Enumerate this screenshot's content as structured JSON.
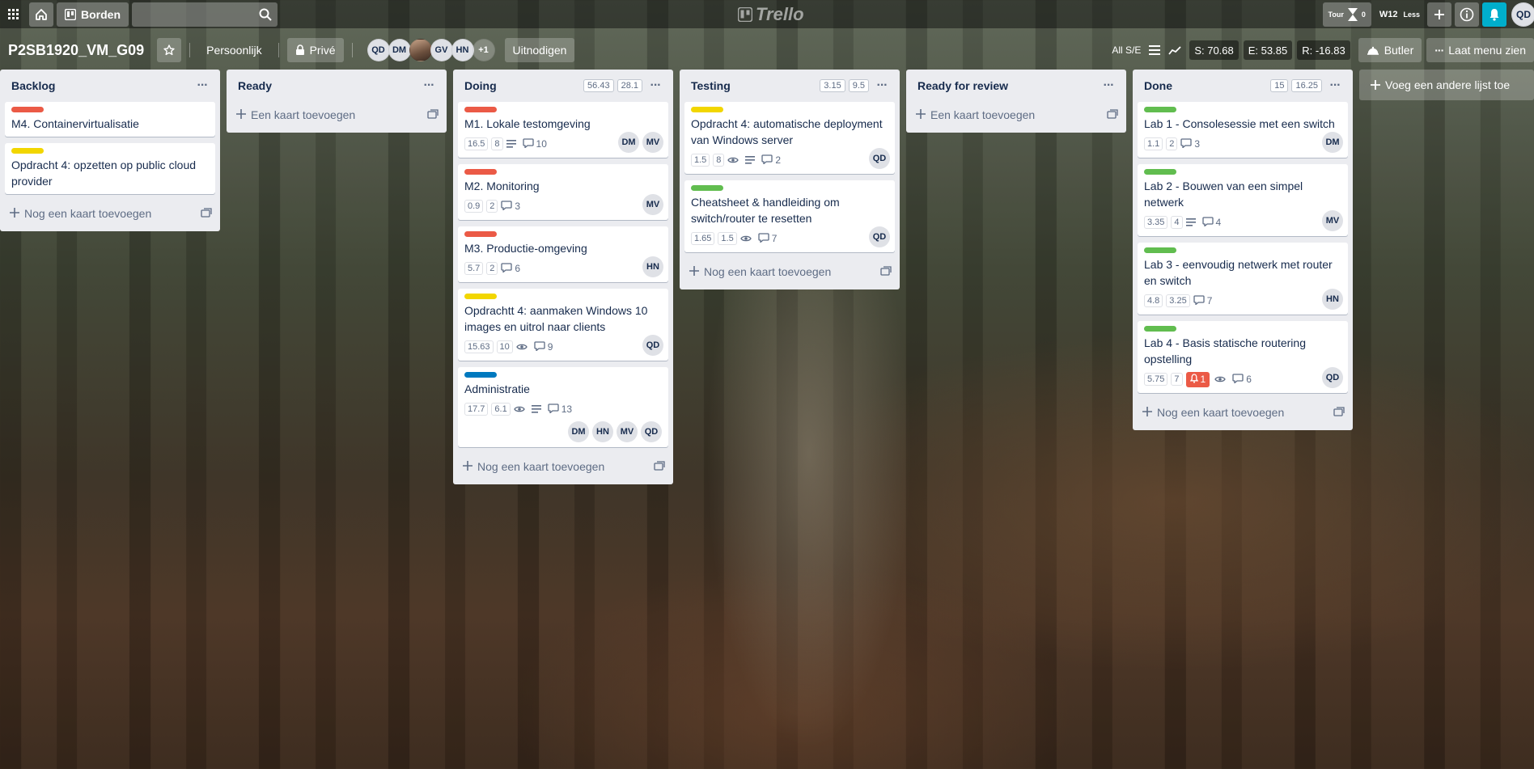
{
  "header": {
    "boards_label": "Borden",
    "search_placeholder": "",
    "logo_text": "Trello",
    "tour_label": "Tour",
    "tour_count": "0",
    "week_label": "W12",
    "less_label": "Less",
    "user_initials": "QD"
  },
  "board": {
    "title": "P2SB1920_VM_G09",
    "personal_label": "Persoonlijk",
    "private_label": "Privé",
    "members": [
      "QD",
      "DM",
      "",
      "GV",
      "HN"
    ],
    "more_members": "+1",
    "invite_label": "Uitnodigen",
    "all_se": "All S/E",
    "stat_s": "S: 70.68",
    "stat_e": "E: 53.85",
    "stat_r": "R: -16.83",
    "butler_label": "Butler",
    "menu_label": "Laat menu zien"
  },
  "lists": [
    {
      "title": "Backlog",
      "badges": [],
      "cards": [
        {
          "label_color": "#eb5a46",
          "title": "M4. Containervirtualisatie"
        },
        {
          "label_color": "#f2d600",
          "title": "Opdracht 4: opzetten op public cloud provider"
        }
      ],
      "add_label": "Nog een kaart toevoegen"
    },
    {
      "title": "Ready",
      "badges": [],
      "cards": [],
      "add_label": "Een kaart toevoegen"
    },
    {
      "title": "Doing",
      "badges": [
        "56.43",
        "28.1"
      ],
      "cards": [
        {
          "label_color": "#eb5a46",
          "title": "M1. Lokale testomgeving",
          "n1": "16.5",
          "n2": "8",
          "desc": true,
          "comments": "10",
          "members": [
            "DM",
            "MV"
          ]
        },
        {
          "label_color": "#eb5a46",
          "title": "M2. Monitoring",
          "n1": "0.9",
          "n2": "2",
          "comments": "3",
          "members": [
            "MV"
          ]
        },
        {
          "label_color": "#eb5a46",
          "title": "M3. Productie-omgeving",
          "n1": "5.7",
          "n2": "2",
          "comments": "6",
          "members": [
            "HN"
          ]
        },
        {
          "label_color": "#f2d600",
          "title": "Opdrachtt 4: aanmaken Windows 10 images en uitrol naar clients",
          "n1": "15.63",
          "n2": "10",
          "watch": true,
          "comments": "9",
          "members": [
            "QD"
          ]
        },
        {
          "label_color": "#0079bf",
          "title": "Administratie",
          "n1": "17.7",
          "n2": "6.1",
          "watch": true,
          "desc": true,
          "comments": "13",
          "members": [
            "DM",
            "HN",
            "MV",
            "QD"
          ]
        }
      ],
      "add_label": "Nog een kaart toevoegen"
    },
    {
      "title": "Testing",
      "badges": [
        "3.15",
        "9.5"
      ],
      "cards": [
        {
          "label_color": "#f2d600",
          "title": "Opdracht 4: automatische deployment van Windows server",
          "n1": "1.5",
          "n2": "8",
          "watch": true,
          "desc": true,
          "comments": "2",
          "members": [
            "QD"
          ]
        },
        {
          "label_color": "#61bd4f",
          "title": "Cheatsheet & handleiding om switch/router te resetten",
          "n1": "1.65",
          "n2": "1.5",
          "watch": true,
          "comments": "7",
          "members": [
            "QD"
          ]
        }
      ],
      "add_label": "Nog een kaart toevoegen"
    },
    {
      "title": "Ready for review",
      "badges": [],
      "cards": [],
      "add_label": "Een kaart toevoegen"
    },
    {
      "title": "Done",
      "badges": [
        "15",
        "16.25"
      ],
      "cards": [
        {
          "label_color": "#61bd4f",
          "title": "Lab 1 - Consolesessie met een switch",
          "n1": "1.1",
          "n2": "2",
          "comments": "3",
          "members": [
            "DM"
          ]
        },
        {
          "label_color": "#61bd4f",
          "title": "Lab 2 - Bouwen van een simpel netwerk",
          "n1": "3.35",
          "n2": "4",
          "desc": true,
          "comments": "4",
          "members": [
            "MV"
          ]
        },
        {
          "label_color": "#61bd4f",
          "title": "Lab 3 - eenvoudig netwerk met router en switch",
          "n1": "4.8",
          "n2": "3.25",
          "comments": "7",
          "members": [
            "HN"
          ]
        },
        {
          "label_color": "#61bd4f",
          "title": "Lab 4 - Basis statische routering opstelling",
          "n1": "5.75",
          "n2": "7",
          "alert": "1",
          "watch": true,
          "comments": "6",
          "members": [
            "QD"
          ]
        }
      ],
      "add_label": "Nog een kaart toevoegen"
    }
  ],
  "add_list_label": "Voeg een andere lijst toe"
}
